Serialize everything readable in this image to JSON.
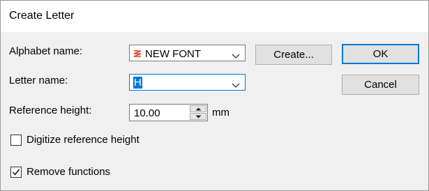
{
  "window": {
    "title": "Create Letter"
  },
  "form": {
    "alphabet_label": "Alphabet name:",
    "alphabet_value": "NEW FONT",
    "letter_label": "Letter name:",
    "letter_value": "H",
    "ref_height_label": "Reference height:",
    "ref_height_value": "10.00",
    "ref_height_unit": "mm",
    "digitize_label": "Digitize reference height",
    "digitize_checked": false,
    "remove_label": "Remove functions",
    "remove_checked": true
  },
  "buttons": {
    "create": "Create...",
    "ok": "OK",
    "cancel": "Cancel"
  },
  "icons": {
    "alphabet_icon": "font-stroke-icon",
    "alphabet_icon_color": "#e2432a",
    "dropdown": "chevron-down-icon",
    "spin": "spin-up-down-icons",
    "check": "checkmark-icon"
  },
  "colors": {
    "accent": "#0078d7",
    "dialog_bg": "#f0f0f0",
    "titlebar_bg": "#ffffff",
    "button_bg": "#e1e1e1"
  }
}
